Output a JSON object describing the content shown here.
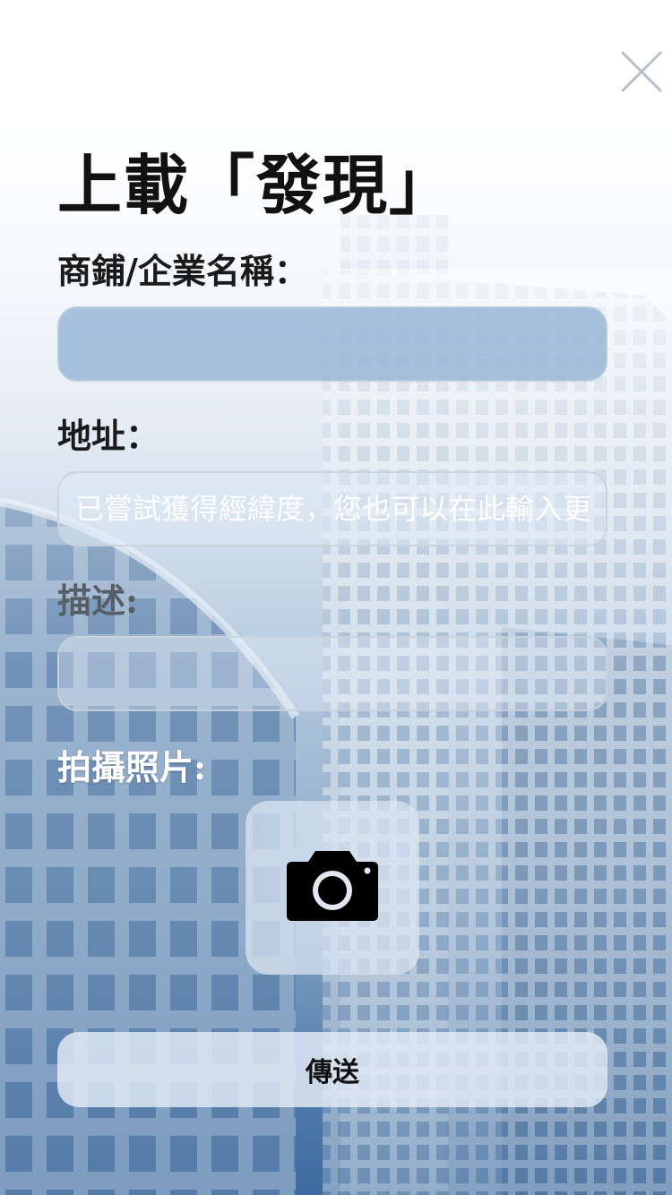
{
  "title": "上載「發現」",
  "close_icon": "close-icon",
  "form": {
    "shop_name_label": "商鋪/企業名稱：",
    "shop_name_value": "",
    "address_label": "地址：",
    "address_placeholder": "已嘗試獲得經緯度，您也可以在此輸入更",
    "description_label": "描述:",
    "description_value": "",
    "photo_label": "拍攝照片:",
    "camera_icon": "camera-icon",
    "submit_label": "傳送"
  },
  "colors": {
    "title": "#111111",
    "filled_field": "#8cafd2",
    "submit_bg": "#e4ecf6",
    "bottom_bg": "#3d6aa0"
  }
}
